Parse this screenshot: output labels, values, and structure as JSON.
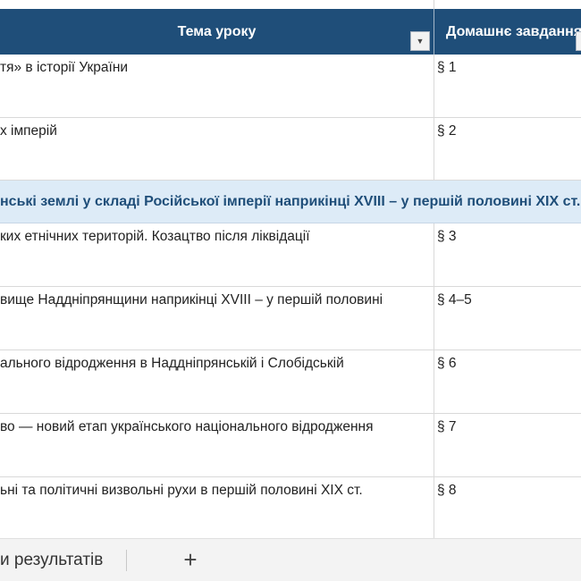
{
  "table": {
    "headers": {
      "topic": "Тема уроку",
      "homework": "Домашнє завдання"
    },
    "rows": [
      {
        "topic": "тя» в історії України",
        "homework": "§ 1"
      },
      {
        "topic": "х імперій",
        "homework": "§ 2"
      },
      {
        "section": "нські землі у складі Російської імперії наприкінці XVIII – у першій половині XIX ст."
      },
      {
        "topic": "ких етнічних територій. Козацтво після ліквідації",
        "homework": "§ 3"
      },
      {
        "topic": "вище Наддніпрянщини наприкінці XVIII – у першій половині",
        "homework": "§ 4–5"
      },
      {
        "topic": "ального відродження в Наддніпрянській і Слобідській",
        "homework": "§ 6"
      },
      {
        "topic": "во — новий етап українського національного відродження",
        "homework": "§ 7"
      },
      {
        "topic": "ьні та політичні визвольні рухи в першій половині XIX ст.",
        "homework": "§ 8"
      }
    ]
  },
  "sheet_tabs": {
    "active_tab": "и результатів",
    "add_sheet": "+"
  },
  "icons": {
    "filter": "filter-dropdown-icon",
    "add": "plus-icon"
  },
  "colors": {
    "header_bg": "#1f4e79",
    "section_bg": "#ddebf7",
    "section_text": "#1f4e79"
  }
}
